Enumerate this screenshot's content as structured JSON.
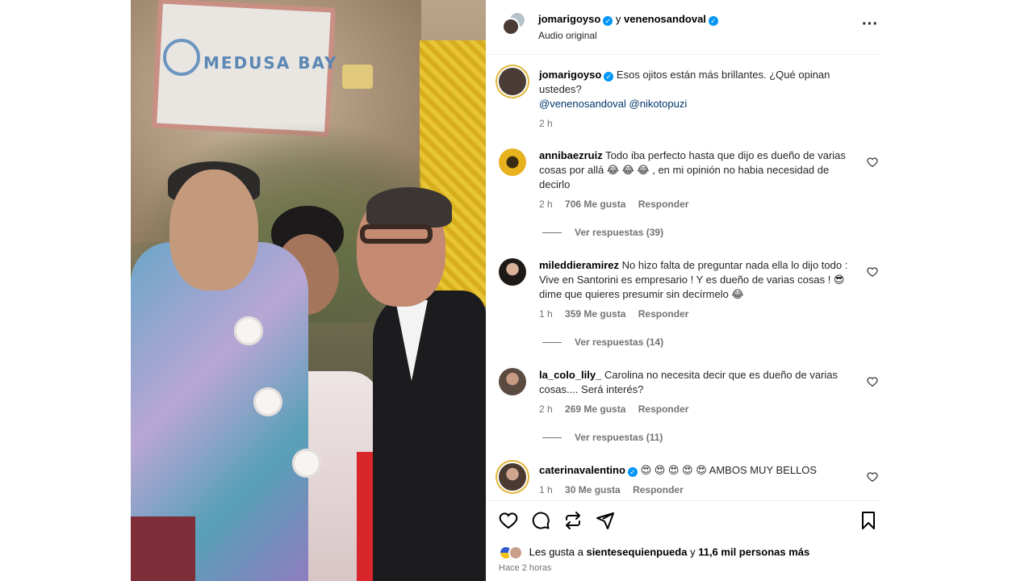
{
  "post": {
    "author": "jomarigoyso",
    "connector": "y",
    "coauthor": "venenosandoval",
    "audio": "Audio original",
    "caption_author": "jomarigoyso",
    "caption": "Esos ojitos están más brillantes. ¿Qué opinan ustedes?",
    "mentions": [
      "@venenosandoval",
      "@nikotopuzi"
    ],
    "caption_time": "2 h",
    "sign_text": "MEDUSA BAY"
  },
  "comments": [
    {
      "user": "annibaezruiz",
      "text": "Todo iba perfecto hasta que dijo es dueño de varias cosas por allá 😂 😂 😂 , en mi opinión no habia necesidad de decirlo",
      "time": "2 h",
      "likes": "706 Me gusta",
      "reply": "Responder",
      "replies": "Ver respuestas (39)",
      "verified": false
    },
    {
      "user": "mileddieramirez",
      "text": "No hizo falta de preguntar nada ella lo dijo todo : Vive en Santorini es empresario ! Y es dueño de varias cosas ! 😎 dime que quieres presumir sin decírmelo 😂",
      "time": "1 h",
      "likes": "359 Me gusta",
      "reply": "Responder",
      "replies": "Ver respuestas (14)",
      "verified": false
    },
    {
      "user": "la_colo_lily_",
      "text": "Carolina no necesita decir que es dueño de varias cosas.... Será interés?",
      "time": "2 h",
      "likes": "269 Me gusta",
      "reply": "Responder",
      "replies": "Ver respuestas (11)",
      "verified": false
    },
    {
      "user": "caterinavalentino",
      "text": "😍 😍 😍 😍 😍 AMBOS MUY BELLOS",
      "time": "1 h",
      "likes": "30 Me gusta",
      "reply": "Responder",
      "verified": true
    }
  ],
  "footer": {
    "likes_prefix": "Les gusta a",
    "liker": "sientesequienpueda",
    "likes_suffix_connector": "y",
    "others": "11,6 mil personas más",
    "posted": "Hace 2 horas"
  },
  "icons": {
    "like": "heart-icon",
    "comment": "comment-icon",
    "share": "repost-icon",
    "send": "send-icon",
    "save": "bookmark-icon",
    "more": "more-options-icon"
  },
  "colors": {
    "link": "#00376b",
    "verified": "#0095f6",
    "meta": "#737373"
  }
}
